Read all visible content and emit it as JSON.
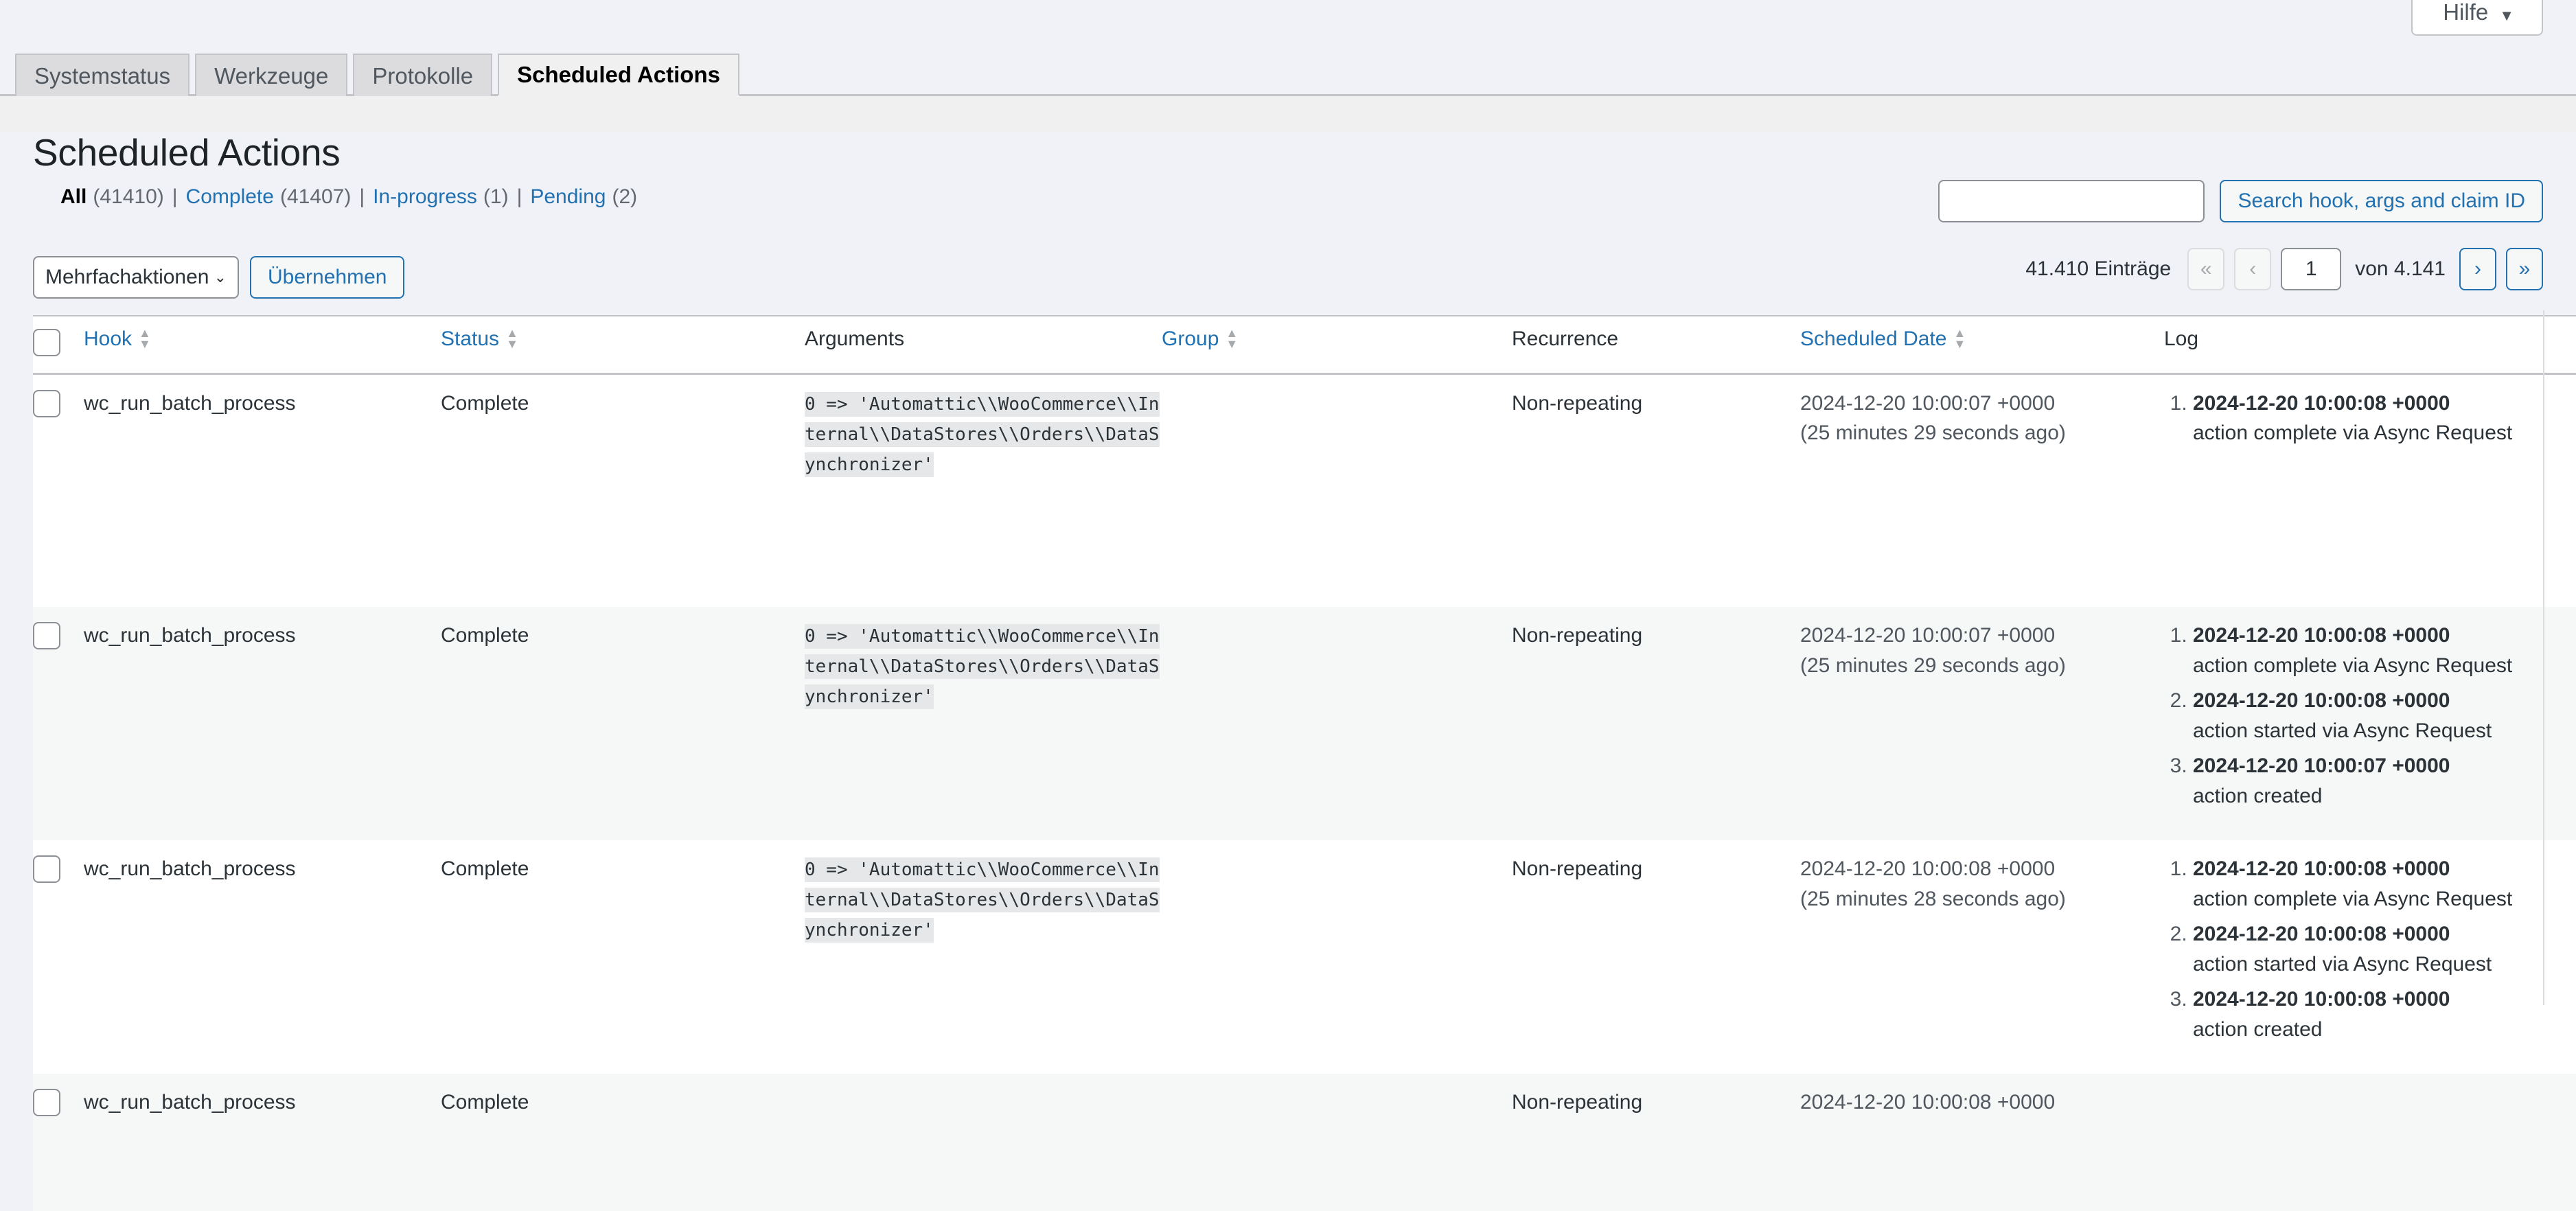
{
  "help": {
    "label": "Hilfe",
    "caret": "▼",
    "icon": "chevron-down-icon"
  },
  "tabs": [
    {
      "label": "Systemstatus",
      "active": false
    },
    {
      "label": "Werkzeuge",
      "active": false
    },
    {
      "label": "Protokolle",
      "active": false
    },
    {
      "label": "Scheduled Actions",
      "active": true
    }
  ],
  "page": {
    "title": "Scheduled Actions"
  },
  "filters": {
    "items": [
      {
        "label": "All",
        "count": "(41410)",
        "current": true
      },
      {
        "label": "Complete",
        "count": "(41407)",
        "current": false
      },
      {
        "label": "In-progress",
        "count": "(1)",
        "current": false
      },
      {
        "label": "Pending",
        "count": "(2)",
        "current": false
      }
    ],
    "separator": "|"
  },
  "search": {
    "value": "",
    "placeholder": "",
    "button_label": "Search hook, args and claim ID"
  },
  "bulk": {
    "selected": "Mehrfachaktionen",
    "caret": "⌄",
    "apply_label": "Übernehmen"
  },
  "pagination": {
    "total_items": "41.410 Einträge",
    "first_label": "«",
    "prev_label": "‹",
    "current_page": "1",
    "total_pages_label": "von 4.141",
    "next_label": "›",
    "last_label": "»"
  },
  "table": {
    "columns": [
      {
        "label": "Hook",
        "sortable": true
      },
      {
        "label": "Status",
        "sortable": true
      },
      {
        "label": "Arguments",
        "sortable": false
      },
      {
        "label": "Group",
        "sortable": true
      },
      {
        "label": "Recurrence",
        "sortable": false
      },
      {
        "label": "Scheduled Date",
        "sortable": true
      },
      {
        "label": "Log",
        "sortable": false
      }
    ],
    "sort_up": "▲",
    "sort_down": "▼",
    "rows": [
      {
        "hook": "wc_run_batch_process",
        "status": "Complete",
        "arguments": "0 => 'Automattic\\\\WooCommerce\\\\Internal\\\\DataStores\\\\Orders\\\\DataSynchronizer'",
        "group": "",
        "recurrence": "Non-repeating",
        "scheduled_date": "2024-12-20 10:00:07 +0000",
        "scheduled_relative": "(25 minutes 29 seconds ago)",
        "log": [
          {
            "time": "2024-12-20 10:00:08 +0000",
            "message": "action complete via Async Request"
          }
        ]
      },
      {
        "hook": "wc_run_batch_process",
        "status": "Complete",
        "arguments": "0 => 'Automattic\\\\WooCommerce\\\\Internal\\\\DataStores\\\\Orders\\\\DataSynchronizer'",
        "group": "",
        "recurrence": "Non-repeating",
        "scheduled_date": "2024-12-20 10:00:07 +0000",
        "scheduled_relative": "(25 minutes 29 seconds ago)",
        "log": [
          {
            "time": "2024-12-20 10:00:08 +0000",
            "message": "action complete via Async Request"
          },
          {
            "time": "2024-12-20 10:00:08 +0000",
            "message": "action started via Async Request"
          },
          {
            "time": "2024-12-20 10:00:07 +0000",
            "message": "action created"
          }
        ]
      },
      {
        "hook": "wc_run_batch_process",
        "status": "Complete",
        "arguments": "0 => 'Automattic\\\\WooCommerce\\\\Internal\\\\DataStores\\\\Orders\\\\DataSynchronizer'",
        "group": "",
        "recurrence": "Non-repeating",
        "scheduled_date": "2024-12-20 10:00:08 +0000",
        "scheduled_relative": "(25 minutes 28 seconds ago)",
        "log": [
          {
            "time": "2024-12-20 10:00:08 +0000",
            "message": "action complete via Async Request"
          },
          {
            "time": "2024-12-20 10:00:08 +0000",
            "message": "action started via Async Request"
          },
          {
            "time": "2024-12-20 10:00:08 +0000",
            "message": "action created"
          }
        ]
      },
      {
        "hook": "wc_run_batch_process",
        "status": "Complete",
        "arguments": "",
        "group": "",
        "recurrence": "Non-repeating",
        "scheduled_date": "2024-12-20 10:00:08 +0000",
        "scheduled_relative": "",
        "log": []
      }
    ]
  }
}
